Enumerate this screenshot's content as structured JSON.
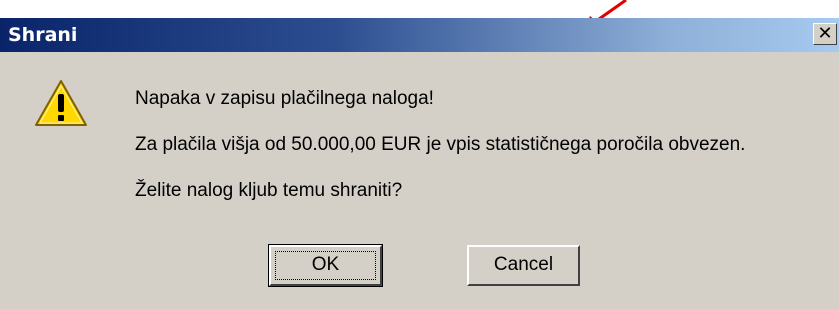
{
  "window": {
    "title": "Shrani",
    "close_glyph": "✕"
  },
  "message": {
    "line1": "Napaka v zapisu plačilnega naloga!",
    "line2": "Za plačila višja od 50.000,00 EUR je vpis statističnega poročila obvezen.",
    "line3": "Želite nalog kljub temu shraniti?"
  },
  "buttons": {
    "ok_label": "OK",
    "cancel_label": "Cancel"
  },
  "icons": {
    "warning": "warning-icon",
    "close": "close-icon",
    "annotation": "arrow-icon"
  },
  "colors": {
    "titlebar_start": "#0a246a",
    "titlebar_end": "#a6caf0",
    "dialog_bg": "#d4d0c8",
    "warning_yellow": "#ffd800",
    "annotation_red": "#e00000"
  }
}
